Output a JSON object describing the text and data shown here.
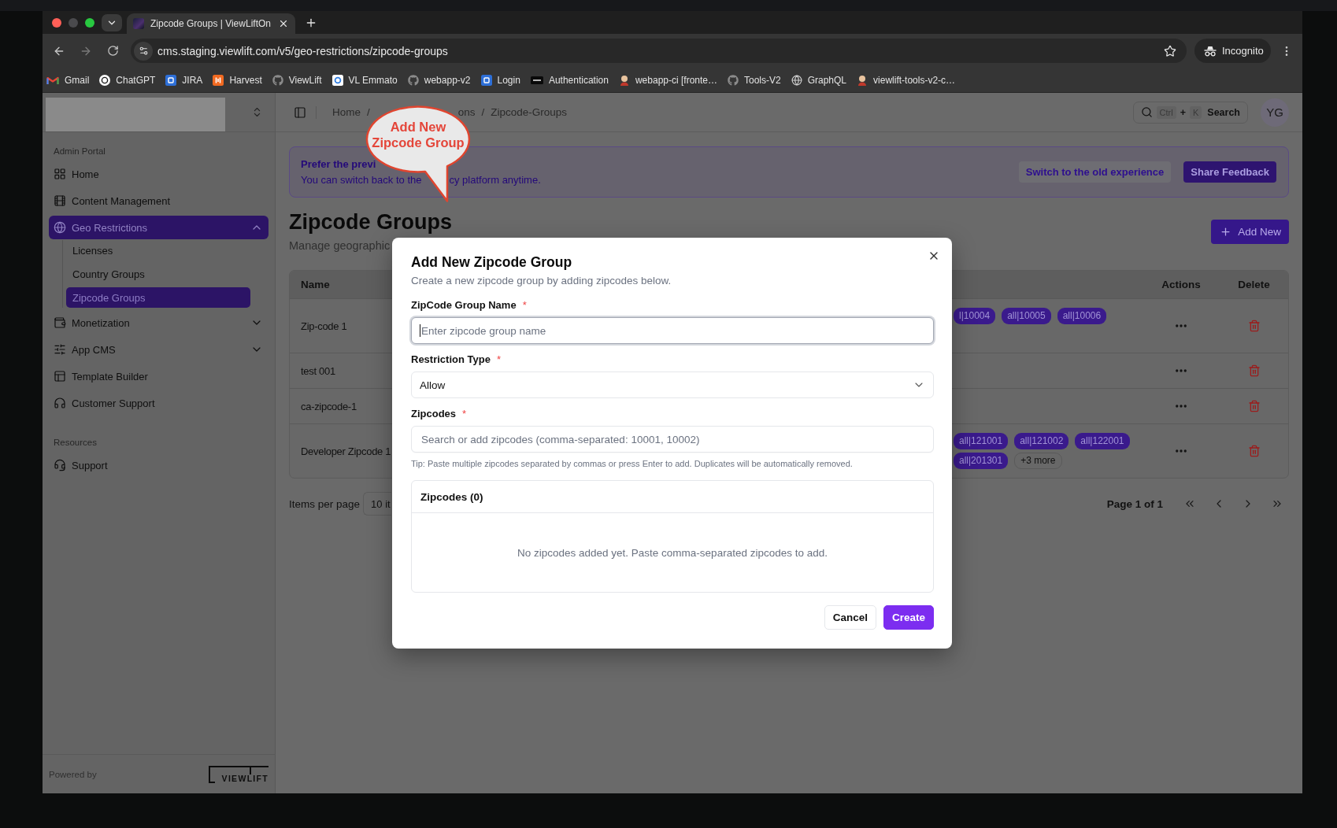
{
  "browser": {
    "tab": {
      "title": "Zipcode Groups | ViewLiftOn"
    },
    "address": "cms.staging.viewlift.com/v5/geo-restrictions/zipcode-groups",
    "profile": "Incognito",
    "bookmarks": [
      "Gmail",
      "ChatGPT",
      "JIRA",
      "Harvest",
      "ViewLift",
      "VL Emmato",
      "webapp-v2",
      "Login",
      "Authentication",
      "webapp-ci [fronte…",
      "Tools-V2",
      "GraphQL",
      "viewlift-tools-v2-c…"
    ]
  },
  "sidebar": {
    "sections": [
      {
        "title": "Admin Portal",
        "items": [
          {
            "label": "Home",
            "selected": false
          },
          {
            "label": "Content Management",
            "selected": false
          },
          {
            "label": "Geo Restrictions",
            "selected": true,
            "expanded": true,
            "children": [
              {
                "label": "Licenses",
                "selected": false
              },
              {
                "label": "Country Groups",
                "selected": false
              },
              {
                "label": "Zipcode Groups",
                "selected": true
              }
            ]
          },
          {
            "label": "Monetization",
            "selected": false,
            "expanded": false
          },
          {
            "label": "App CMS",
            "selected": false,
            "expanded": false
          },
          {
            "label": "Template Builder",
            "selected": false
          },
          {
            "label": "Customer Support",
            "selected": false
          }
        ]
      },
      {
        "title": "Resources",
        "items": [
          {
            "label": "Support",
            "selected": false
          }
        ]
      }
    ],
    "footer": {
      "caption": "Powered by",
      "logo": "VIEWLIFT"
    }
  },
  "topbar": {
    "breadcrumb": {
      "separator": "/",
      "items": [
        "Home",
        "ons",
        "Zipcode-Groups"
      ]
    },
    "search": {
      "keys": [
        "Ctrl",
        "K"
      ],
      "joiner": "+",
      "label": "Search"
    },
    "avatar": "YG"
  },
  "banner": {
    "title": "Prefer the previ",
    "message": [
      "You can switch back to the",
      "cy platform anytime."
    ],
    "buttons": [
      {
        "label": "Switch to the old experience",
        "kind": "secondary"
      },
      {
        "label": "Share Feedback",
        "kind": "primary"
      }
    ]
  },
  "page": {
    "title": "Zipcode Groups",
    "subtitle": "Manage geographic",
    "add_button": "Add New"
  },
  "table": {
    "columns": [
      "Name",
      "Actions",
      "Delete"
    ],
    "rows": [
      {
        "name": "Zip-code 1",
        "zipcodes": [
          "l|10004",
          "all|10005",
          "all|10006"
        ]
      },
      {
        "name": "test 001"
      },
      {
        "name": "ca-zipcode-1"
      },
      {
        "name": "Developer Zipcode 1",
        "zipcodes": [
          "all|121001",
          "all|121002",
          "all|122001",
          "all|201301"
        ],
        "more": "+3 more"
      }
    ]
  },
  "pagination": {
    "label": "Items per page",
    "page_size": "10 it",
    "page_info": "Page 1 of 1"
  },
  "modal": {
    "title": "Add New Zipcode Group",
    "description": "Create a new zipcode group by adding zipcodes below.",
    "fields": [
      {
        "kind": "input",
        "label": "ZipCode Group Name",
        "required_mark": "*",
        "placeholder": "Enter zipcode group name",
        "focused": true
      },
      {
        "kind": "select",
        "label": "Restriction Type",
        "required_mark": "*",
        "value": "Allow"
      },
      {
        "kind": "input",
        "label": "Zipcodes",
        "required_mark": "*",
        "placeholder": "Search or add zipcodes (comma-separated: 10001, 10002)",
        "focused": false,
        "hint": "Tip: Paste multiple zipcodes separated by commas or press Enter to add. Duplicates will be automatically removed."
      }
    ],
    "list": {
      "title": "Zipcodes (0)",
      "empty_text": "No zipcodes added yet. Paste comma-separated zipcodes to add."
    },
    "buttons": [
      {
        "label": "Cancel",
        "kind": "secondary"
      },
      {
        "label": "Create",
        "kind": "primary"
      }
    ]
  },
  "callout": {
    "lines": [
      "Add New",
      "Zipcode Group"
    ]
  }
}
